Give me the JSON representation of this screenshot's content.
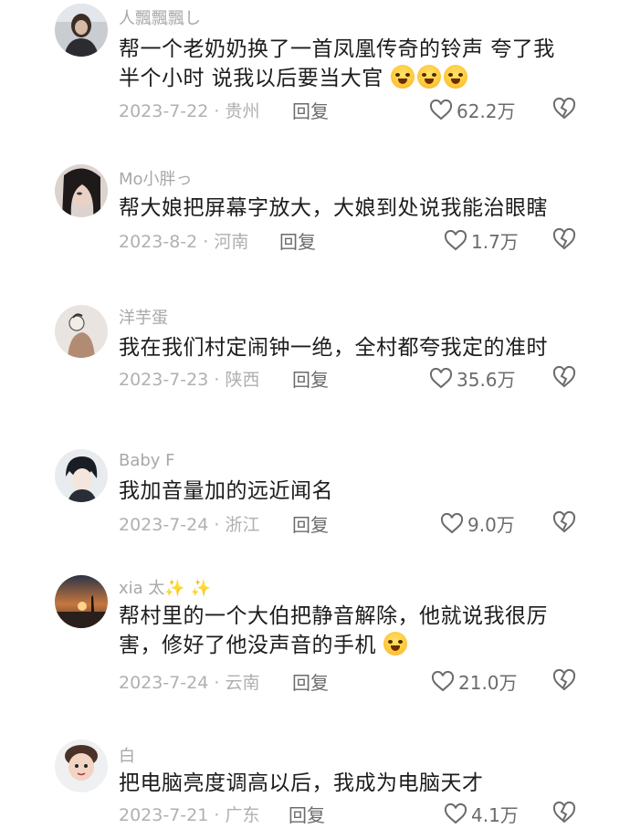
{
  "comments": [
    {
      "username": "人飄飄飄し",
      "text": "帮一个老奶奶换了一首凤凰传奇的铃声 夸了我半个小时 说我以后要当大官",
      "emoji": [
        "laughing-crying-emoji",
        "laughing-crying-emoji",
        "laughing-crying-emoji"
      ],
      "date_location": "2023-7-22 · 贵州",
      "reply": "回复",
      "likes": "62.2万"
    },
    {
      "username": "Mo小胖っ",
      "text": "帮大娘把屏幕字放大，大娘到处说我能治眼瞎",
      "emoji": [],
      "date_location": "2023-8-2 · 河南",
      "reply": "回复",
      "likes": "1.7万"
    },
    {
      "username": "洋芋蛋",
      "text": "我在我们村定闹钟一绝，全村都夸我定的准时",
      "emoji": [],
      "date_location": "2023-7-23 · 陕西",
      "reply": "回复",
      "likes": "35.6万"
    },
    {
      "username": "Baby F",
      "text": "我加音量加的远近闻名",
      "emoji": [],
      "date_location": "2023-7-24 · 浙江",
      "reply": "回复",
      "likes": "9.0万"
    },
    {
      "username": "xia 太✨ ✨",
      "text": "帮村里的一个大伯把静音解除，他就说我很厉害，修好了他没声音的手机",
      "emoji": [
        "loudly-crying-emoji"
      ],
      "date_location": "2023-7-24 · 云南",
      "reply": "回复",
      "likes": "21.0万"
    },
    {
      "username": "白",
      "text": "把电脑亮度调高以后，我成为电脑天才",
      "emoji": [],
      "date_location": "2023-7-21 · 广东",
      "reply": "回复",
      "likes": "4.1万"
    }
  ],
  "colors": {
    "meta": "#b0b0b0",
    "text": "#1c1c1c",
    "username": "#a8a8a8"
  },
  "icons": {
    "like": "heart-outline-icon",
    "dislike": "broken-heart-icon"
  }
}
